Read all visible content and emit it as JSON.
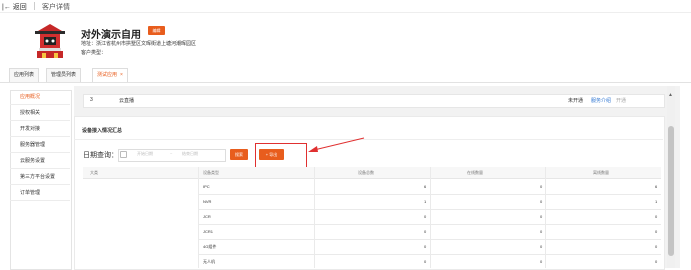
{
  "topbar": {
    "back": "|← 返回",
    "crumb": "客户详情"
  },
  "header": {
    "title": "对外演示自用",
    "edit_label": "编辑",
    "address": "地址：浙江省杭州市拱墅区文晖街道上塘河潮晖园区",
    "customer_type": "客户类型："
  },
  "tabs": [
    {
      "label": "应用列表"
    },
    {
      "label": "管理员列表"
    },
    {
      "label": "测试应用",
      "close": "×"
    }
  ],
  "sidebar": {
    "items": [
      {
        "label": "应用概况"
      },
      {
        "label": "授权相关"
      },
      {
        "label": "开发对接"
      },
      {
        "label": "服务器管理"
      },
      {
        "label": "云服务设置"
      },
      {
        "label": "第三方平台设置"
      },
      {
        "label": "订单管理"
      }
    ]
  },
  "service_row": {
    "num": "3",
    "name": "云直播",
    "status": "未开通",
    "link": "服务介绍",
    "link2": "开通"
  },
  "device_card": {
    "title": "设备接入情况汇总",
    "date_label": "日期查询：",
    "start_placeholder": "开始日期",
    "sep": "~",
    "end_placeholder": "结束日期",
    "search_label": "搜索",
    "export_label": "+ 导出"
  },
  "table": {
    "headers": [
      "大类",
      "设备类型",
      "设备总数",
      "在线数量",
      "离线数量"
    ],
    "rows": [
      {
        "type": "IPC",
        "total": "6",
        "online": "0",
        "offline": "6"
      },
      {
        "type": "NVR",
        "total": "1",
        "online": "0",
        "offline": "1"
      },
      {
        "type": "JCR",
        "total": "0",
        "online": "0",
        "offline": "0"
      },
      {
        "type": "JCR1",
        "total": "0",
        "online": "0",
        "offline": "0"
      },
      {
        "type": "4G组件",
        "total": "0",
        "online": "0",
        "offline": "0"
      },
      {
        "type": "无人机",
        "total": "0",
        "online": "0",
        "offline": "0"
      }
    ]
  },
  "colors": {
    "accent": "#e85d1d",
    "link": "#2f76d2",
    "annotation": "#e03030"
  }
}
